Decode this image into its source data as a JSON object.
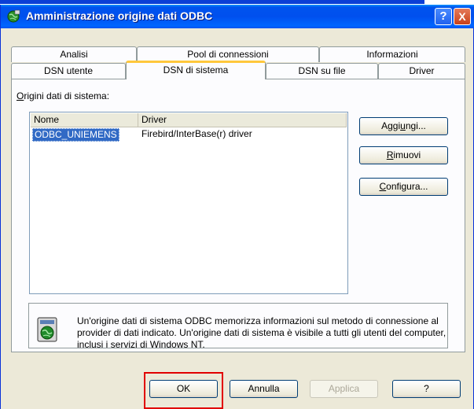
{
  "window": {
    "title": "Amministrazione origine dati ODBC",
    "help_glyph": "?",
    "close_glyph": "X"
  },
  "tabs": {
    "row_back": [
      "Analisi",
      "Pool di connessioni",
      "Informazioni"
    ],
    "row_front": [
      "DSN utente",
      "DSN di sistema",
      "DSN su file",
      "Driver"
    ],
    "selected": "DSN di sistema"
  },
  "panel": {
    "label_prefix": "O",
    "label_rest": "rigini dati di sistema:",
    "columns": [
      "Nome",
      "Driver"
    ],
    "rows": [
      {
        "name": "ODBC_UNIEMENS",
        "driver": "Firebird/InterBase(r) driver"
      }
    ],
    "buttons": {
      "add_pre": "Aggi",
      "add_ul": "u",
      "add_post": "ngi...",
      "remove_pre": "",
      "remove_ul": "R",
      "remove_post": "imuovi",
      "configure_pre": "",
      "configure_ul": "C",
      "configure_post": "onfigura..."
    },
    "info_text": "Un'origine dati di sistema ODBC memorizza informazioni sul metodo di connessione al provider di dati indicato. Un'origine dati di sistema è visibile a tutti gli utenti del computer, inclusi i servizi di Windows NT."
  },
  "footer": {
    "ok": "OK",
    "cancel": "Annulla",
    "apply": "Applica",
    "help": "?"
  },
  "icons": {
    "title_icon": "odbc-globe-icon",
    "info_icon": "computer-globe-icon"
  },
  "colors": {
    "titlebar": "#0053ee",
    "selection": "#316ac5",
    "highlight_box": "#e10000",
    "tab_accent": "#ffc83c"
  }
}
